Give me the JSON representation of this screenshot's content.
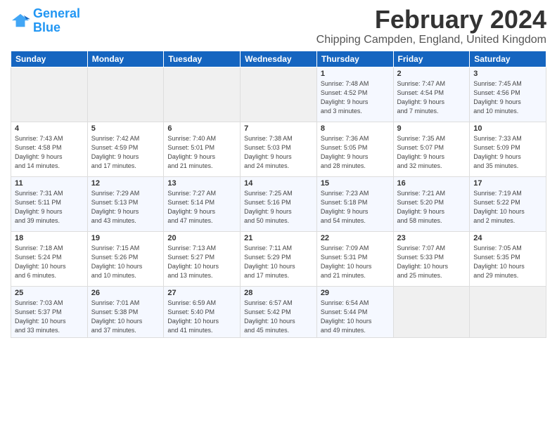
{
  "header": {
    "logo_line1": "General",
    "logo_line2": "Blue",
    "month_year": "February 2024",
    "location": "Chipping Campden, England, United Kingdom"
  },
  "weekdays": [
    "Sunday",
    "Monday",
    "Tuesday",
    "Wednesday",
    "Thursday",
    "Friday",
    "Saturday"
  ],
  "weeks": [
    [
      {
        "day": "",
        "info": ""
      },
      {
        "day": "",
        "info": ""
      },
      {
        "day": "",
        "info": ""
      },
      {
        "day": "",
        "info": ""
      },
      {
        "day": "1",
        "info": "Sunrise: 7:48 AM\nSunset: 4:52 PM\nDaylight: 9 hours\nand 3 minutes."
      },
      {
        "day": "2",
        "info": "Sunrise: 7:47 AM\nSunset: 4:54 PM\nDaylight: 9 hours\nand 7 minutes."
      },
      {
        "day": "3",
        "info": "Sunrise: 7:45 AM\nSunset: 4:56 PM\nDaylight: 9 hours\nand 10 minutes."
      }
    ],
    [
      {
        "day": "4",
        "info": "Sunrise: 7:43 AM\nSunset: 4:58 PM\nDaylight: 9 hours\nand 14 minutes."
      },
      {
        "day": "5",
        "info": "Sunrise: 7:42 AM\nSunset: 4:59 PM\nDaylight: 9 hours\nand 17 minutes."
      },
      {
        "day": "6",
        "info": "Sunrise: 7:40 AM\nSunset: 5:01 PM\nDaylight: 9 hours\nand 21 minutes."
      },
      {
        "day": "7",
        "info": "Sunrise: 7:38 AM\nSunset: 5:03 PM\nDaylight: 9 hours\nand 24 minutes."
      },
      {
        "day": "8",
        "info": "Sunrise: 7:36 AM\nSunset: 5:05 PM\nDaylight: 9 hours\nand 28 minutes."
      },
      {
        "day": "9",
        "info": "Sunrise: 7:35 AM\nSunset: 5:07 PM\nDaylight: 9 hours\nand 32 minutes."
      },
      {
        "day": "10",
        "info": "Sunrise: 7:33 AM\nSunset: 5:09 PM\nDaylight: 9 hours\nand 35 minutes."
      }
    ],
    [
      {
        "day": "11",
        "info": "Sunrise: 7:31 AM\nSunset: 5:11 PM\nDaylight: 9 hours\nand 39 minutes."
      },
      {
        "day": "12",
        "info": "Sunrise: 7:29 AM\nSunset: 5:13 PM\nDaylight: 9 hours\nand 43 minutes."
      },
      {
        "day": "13",
        "info": "Sunrise: 7:27 AM\nSunset: 5:14 PM\nDaylight: 9 hours\nand 47 minutes."
      },
      {
        "day": "14",
        "info": "Sunrise: 7:25 AM\nSunset: 5:16 PM\nDaylight: 9 hours\nand 50 minutes."
      },
      {
        "day": "15",
        "info": "Sunrise: 7:23 AM\nSunset: 5:18 PM\nDaylight: 9 hours\nand 54 minutes."
      },
      {
        "day": "16",
        "info": "Sunrise: 7:21 AM\nSunset: 5:20 PM\nDaylight: 9 hours\nand 58 minutes."
      },
      {
        "day": "17",
        "info": "Sunrise: 7:19 AM\nSunset: 5:22 PM\nDaylight: 10 hours\nand 2 minutes."
      }
    ],
    [
      {
        "day": "18",
        "info": "Sunrise: 7:18 AM\nSunset: 5:24 PM\nDaylight: 10 hours\nand 6 minutes."
      },
      {
        "day": "19",
        "info": "Sunrise: 7:15 AM\nSunset: 5:26 PM\nDaylight: 10 hours\nand 10 minutes."
      },
      {
        "day": "20",
        "info": "Sunrise: 7:13 AM\nSunset: 5:27 PM\nDaylight: 10 hours\nand 13 minutes."
      },
      {
        "day": "21",
        "info": "Sunrise: 7:11 AM\nSunset: 5:29 PM\nDaylight: 10 hours\nand 17 minutes."
      },
      {
        "day": "22",
        "info": "Sunrise: 7:09 AM\nSunset: 5:31 PM\nDaylight: 10 hours\nand 21 minutes."
      },
      {
        "day": "23",
        "info": "Sunrise: 7:07 AM\nSunset: 5:33 PM\nDaylight: 10 hours\nand 25 minutes."
      },
      {
        "day": "24",
        "info": "Sunrise: 7:05 AM\nSunset: 5:35 PM\nDaylight: 10 hours\nand 29 minutes."
      }
    ],
    [
      {
        "day": "25",
        "info": "Sunrise: 7:03 AM\nSunset: 5:37 PM\nDaylight: 10 hours\nand 33 minutes."
      },
      {
        "day": "26",
        "info": "Sunrise: 7:01 AM\nSunset: 5:38 PM\nDaylight: 10 hours\nand 37 minutes."
      },
      {
        "day": "27",
        "info": "Sunrise: 6:59 AM\nSunset: 5:40 PM\nDaylight: 10 hours\nand 41 minutes."
      },
      {
        "day": "28",
        "info": "Sunrise: 6:57 AM\nSunset: 5:42 PM\nDaylight: 10 hours\nand 45 minutes."
      },
      {
        "day": "29",
        "info": "Sunrise: 6:54 AM\nSunset: 5:44 PM\nDaylight: 10 hours\nand 49 minutes."
      },
      {
        "day": "",
        "info": ""
      },
      {
        "day": "",
        "info": ""
      }
    ]
  ]
}
